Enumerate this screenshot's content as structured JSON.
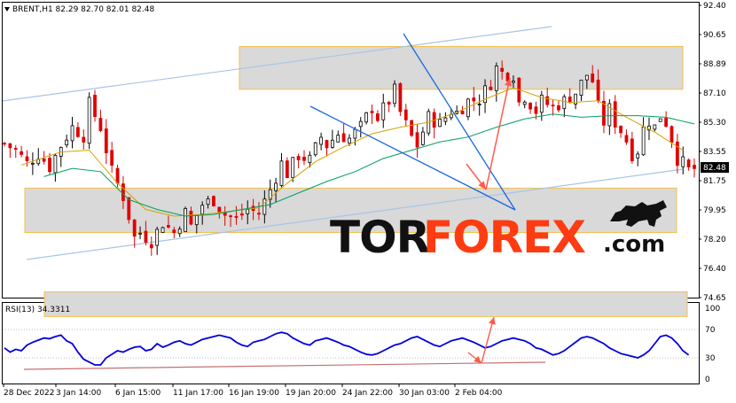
{
  "chart_header": {
    "symbol_line": "BRENT,H1  82.29 82.70 82.01 82.48"
  },
  "rsi_header": "RSI(13) 34.3311",
  "logo": {
    "part1": "TOR",
    "part2": "FOREX",
    "part3": ".com"
  },
  "colors": {
    "bull_candle": "#000000",
    "bear_candle": "#e00000",
    "ma_fast": "#d6a300",
    "ma_slow": "#00a060",
    "rsi_line": "#0000dd",
    "zone_fill": "#d9d9d9",
    "zone_border": "#f5c04a",
    "channel_line": "#a9c4e6",
    "wedge_line": "#1a66e0",
    "arrow": "#ff5a4a",
    "rsi_trendline": "#c47070",
    "logo_dark": "#111111",
    "logo_accent": "#ff3b12"
  },
  "chart_data": [
    {
      "type": "candlestick",
      "symbol": "BRENT",
      "timeframe": "H1",
      "ylim": [
        74.65,
        92.4
      ],
      "y_ticks": [
        "92.40",
        "90.65",
        "88.89",
        "87.10",
        "85.30",
        "83.55",
        "81.75",
        "79.95",
        "78.20",
        "76.40",
        "74.65"
      ],
      "x_ticks": [
        "28 Dec 2022",
        "3 Jan 14:00",
        "6 Jan 15:00",
        "11 Jan 17:00",
        "16 Jan 19:00",
        "19 Jan 20:00",
        "24 Jan 22:00",
        "30 Jan 03:00",
        "2 Feb 04:00"
      ],
      "last_price": "82.48",
      "ohlc": {
        "open": 82.29,
        "high": 82.7,
        "low": 82.01,
        "close": 82.48
      },
      "close_path": [
        [
          0,
          84.0
        ],
        [
          2,
          83.6
        ],
        [
          4,
          82.8
        ],
        [
          6,
          83.4
        ],
        [
          8,
          82.6
        ],
        [
          10,
          83.9
        ],
        [
          12,
          85.0
        ],
        [
          14,
          84.5
        ],
        [
          15,
          86.4
        ],
        [
          17,
          85.0
        ],
        [
          19,
          82.3
        ],
        [
          21,
          80.8
        ],
        [
          22,
          79.6
        ],
        [
          23,
          78.3
        ],
        [
          24,
          78.6
        ],
        [
          26,
          78.1
        ],
        [
          28,
          79.2
        ],
        [
          30,
          78.6
        ],
        [
          32,
          79.8
        ],
        [
          33,
          79.0
        ],
        [
          35,
          80.3
        ],
        [
          37,
          80.6
        ],
        [
          39,
          79.7
        ],
        [
          41,
          79.4
        ],
        [
          43,
          80.0
        ],
        [
          45,
          79.8
        ],
        [
          47,
          81.2
        ],
        [
          49,
          82.8
        ],
        [
          50,
          82.2
        ],
        [
          52,
          83.3
        ],
        [
          54,
          83.0
        ],
        [
          56,
          84.4
        ],
        [
          57,
          83.9
        ],
        [
          59,
          84.6
        ],
        [
          61,
          84.3
        ],
        [
          63,
          85.0
        ],
        [
          65,
          86.2
        ],
        [
          66,
          85.6
        ],
        [
          68,
          86.6
        ],
        [
          69,
          87.2
        ],
        [
          70,
          85.9
        ],
        [
          72,
          84.4
        ],
        [
          73,
          83.9
        ],
        [
          75,
          85.6
        ],
        [
          77,
          85.2
        ],
        [
          79,
          86.0
        ],
        [
          80,
          85.9
        ],
        [
          82,
          86.6
        ],
        [
          84,
          86.7
        ],
        [
          85,
          87.2
        ],
        [
          86,
          87.7
        ],
        [
          87,
          88.6
        ],
        [
          88,
          88.3
        ],
        [
          90,
          88.2
        ],
        [
          91,
          86.5
        ],
        [
          92,
          86.9
        ],
        [
          94,
          86.0
        ],
        [
          95,
          86.6
        ],
        [
          97,
          86.2
        ],
        [
          99,
          86.6
        ],
        [
          101,
          87.1
        ],
        [
          103,
          88.2
        ],
        [
          104,
          87.8
        ],
        [
          105,
          86.2
        ],
        [
          106,
          85.3
        ],
        [
          107,
          86.1
        ],
        [
          108,
          85.3
        ],
        [
          109,
          84.8
        ],
        [
          110,
          84.2
        ],
        [
          111,
          83.4
        ],
        [
          112,
          83.6
        ],
        [
          113,
          84.9
        ],
        [
          114,
          85.4
        ],
        [
          115,
          85.0
        ],
        [
          116,
          85.7
        ],
        [
          117,
          85.3
        ],
        [
          118,
          84.3
        ],
        [
          119,
          83.1
        ],
        [
          120,
          82.8
        ],
        [
          121,
          82.4
        ],
        [
          122,
          82.48
        ]
      ],
      "ma_fast": [
        [
          3,
          82.7
        ],
        [
          10,
          83.5
        ],
        [
          15,
          83.6
        ],
        [
          20,
          81.6
        ],
        [
          25,
          80.0
        ],
        [
          30,
          79.6
        ],
        [
          35,
          79.7
        ],
        [
          40,
          79.9
        ],
        [
          45,
          80.1
        ],
        [
          50,
          81.6
        ],
        [
          55,
          82.9
        ],
        [
          60,
          83.8
        ],
        [
          65,
          84.6
        ],
        [
          70,
          85.0
        ],
        [
          75,
          85.3
        ],
        [
          80,
          85.9
        ],
        [
          85,
          86.7
        ],
        [
          90,
          87.4
        ],
        [
          95,
          86.8
        ],
        [
          100,
          86.5
        ],
        [
          105,
          86.6
        ],
        [
          110,
          85.6
        ],
        [
          115,
          84.7
        ],
        [
          120,
          83.6
        ]
      ],
      "ma_slow": [
        [
          7,
          82.0
        ],
        [
          12,
          82.5
        ],
        [
          17,
          82.3
        ],
        [
          22,
          80.6
        ],
        [
          27,
          80.0
        ],
        [
          32,
          79.6
        ],
        [
          37,
          79.7
        ],
        [
          42,
          80.0
        ],
        [
          47,
          80.3
        ],
        [
          52,
          81.0
        ],
        [
          57,
          81.7
        ],
        [
          62,
          82.3
        ],
        [
          67,
          83.1
        ],
        [
          72,
          83.6
        ],
        [
          77,
          84.1
        ],
        [
          82,
          84.4
        ],
        [
          87,
          85.0
        ],
        [
          92,
          85.5
        ],
        [
          97,
          85.8
        ],
        [
          102,
          85.6
        ],
        [
          107,
          85.7
        ],
        [
          112,
          85.7
        ],
        [
          117,
          85.6
        ],
        [
          122,
          85.2
        ]
      ],
      "bar_count": 122
    },
    {
      "type": "line",
      "indicator": "RSI(13)",
      "value": 34.3311,
      "ylim": [
        0,
        100
      ],
      "y_ticks": [
        "100",
        "70",
        "30",
        "0"
      ],
      "series": [
        {
          "values": [
            44,
            38,
            42,
            40,
            48,
            52,
            55,
            58,
            57,
            60,
            62,
            54,
            50,
            38,
            28,
            24,
            20,
            20,
            30,
            35,
            40,
            38,
            42,
            45,
            46,
            40,
            42,
            50,
            45,
            48,
            52,
            54,
            50,
            48,
            52,
            56,
            58,
            60,
            62,
            60,
            58,
            52,
            48,
            46,
            52,
            54,
            56,
            60,
            64,
            66,
            64,
            58,
            54,
            50,
            48,
            54,
            56,
            58,
            55,
            52,
            48,
            46,
            42,
            38,
            35,
            34,
            36,
            40,
            44,
            48,
            50,
            54,
            58,
            60,
            56,
            52,
            48,
            46,
            50,
            54,
            56,
            58,
            55,
            52,
            48,
            44,
            46,
            50,
            54,
            56,
            58,
            56,
            54,
            50,
            44,
            42,
            38,
            34,
            36,
            40,
            46,
            52,
            58,
            60,
            58,
            54,
            50,
            44,
            40,
            36,
            34,
            32,
            30,
            34,
            40,
            50,
            60,
            62,
            58,
            50,
            40,
            34
          ]
        }
      ]
    }
  ]
}
